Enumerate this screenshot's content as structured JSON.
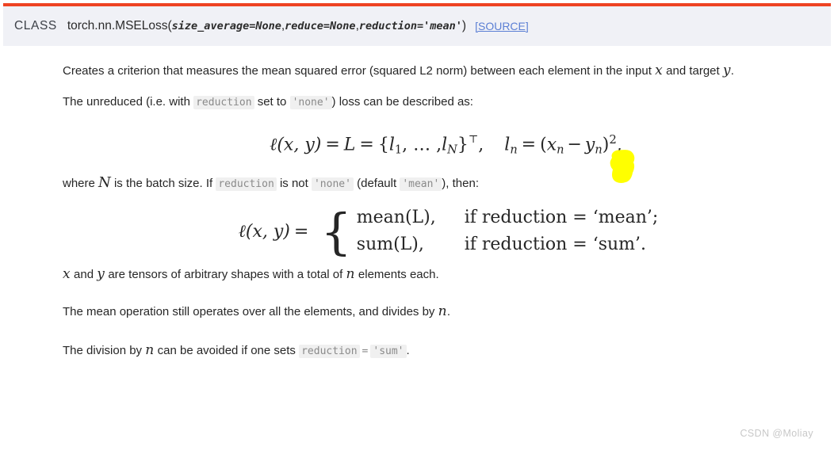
{
  "page": {
    "accent_rule_color": "#ee4323",
    "header_bg": "#f0f1f6",
    "link_color": "#5b7fd4",
    "highlight_color": "#ffff00"
  },
  "signature": {
    "class_tag": "CLASS",
    "qualified_name": "torch.nn.MSELoss",
    "open_paren": "(",
    "params": [
      {
        "text": "size_average=None",
        "separator": ", "
      },
      {
        "text": "reduce=None",
        "separator": ", "
      },
      {
        "text": "reduction='mean'",
        "separator": ""
      }
    ],
    "close_paren": ")",
    "source_link": "[SOURCE]"
  },
  "paragraphs": {
    "p1_a": "Creates a criterion that measures the mean squared error (squared L2 norm) between each element in the input ",
    "p1_var_x": "x",
    "p1_b": " and target ",
    "p1_var_y": "y",
    "p1_c": ".",
    "p2_a": "The unreduced (i.e. with ",
    "p2_code_reduction": "reduction",
    "p2_b": " set to ",
    "p2_code_none": "'none'",
    "p2_c": ") loss can be described as:",
    "p3_a": "where ",
    "p3_var_N": "N",
    "p3_b": " is the batch size. If ",
    "p3_code_reduction": "reduction",
    "p3_c": " is not ",
    "p3_code_none": "'none'",
    "p3_d": " (default ",
    "p3_code_mean": "'mean'",
    "p3_e": "), then:",
    "p4_var_x": "x",
    "p4_a": " and ",
    "p4_var_y": "y",
    "p4_b": " are tensors of arbitrary shapes with a total of ",
    "p4_var_n": "n",
    "p4_c": " elements each.",
    "p5_a": "The mean operation still operates over all the elements, and divides by ",
    "p5_var_n": "n",
    "p5_b": ".",
    "p6_a": "The division by ",
    "p6_var_n": "n",
    "p6_b": " can be avoided if one sets ",
    "p6_code_reduction": "reduction",
    "p6_eq": "=",
    "p6_code_sum": "'sum'",
    "p6_c": "."
  },
  "equation1": {
    "ell": "ℓ",
    "lhs_args": "(x, y)",
    "eq1": "=",
    "L": "L",
    "eq2": "=",
    "set_open": "{",
    "l1": "l",
    "l1_sub": "1",
    "dots": ", … ,",
    "lN": "l",
    "lN_sub": "N",
    "set_close": "}",
    "transpose": "⊤",
    "comma1": ",",
    "ln": "l",
    "ln_sub": "n",
    "eq3": "=",
    "rhs_open": "(",
    "xn": "x",
    "xn_sub": "n",
    "minus": "−",
    "yn": "y",
    "yn_sub": "n",
    "rhs_close": ")",
    "exponent": "2",
    "comma2": ","
  },
  "equation2": {
    "lhs_ell": "ℓ",
    "lhs_args": "(x, y)",
    "equals": "=",
    "brace": "{",
    "rows": [
      {
        "value": "mean(L),",
        "condition": "if reduction = ‘mean’;"
      },
      {
        "value": "sum(L),",
        "condition": "if reduction = ‘sum’."
      }
    ]
  },
  "watermark": {
    "text": "CSDN @Moliay"
  }
}
